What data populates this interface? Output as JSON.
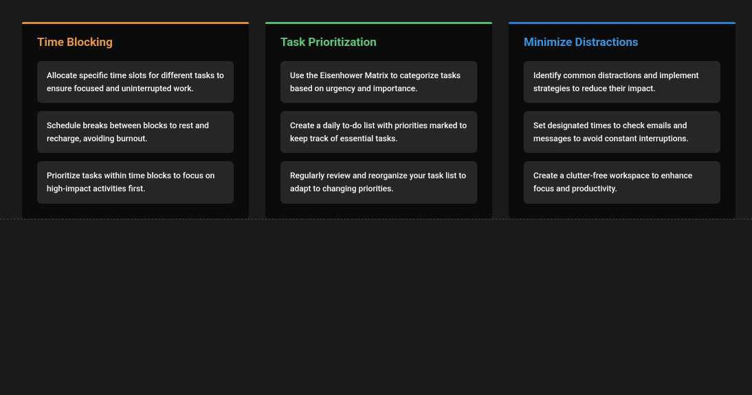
{
  "cards": [
    {
      "title": "Time Blocking",
      "accent": "#e08a3c",
      "title_color": "#e8964a",
      "tips": [
        "Allocate specific time slots for different tasks to ensure focused and uninterrupted work.",
        "Schedule breaks between blocks to rest and recharge, avoiding burnout.",
        "Prioritize tasks within time blocks to focus on high-impact activities first."
      ]
    },
    {
      "title": "Task Prioritization",
      "accent": "#52b96e",
      "title_color": "#5fc77b",
      "tips": [
        "Use the Eisenhower Matrix to categorize tasks based on urgency and importance.",
        "Create a daily to-do list with priorities marked to keep track of essential tasks.",
        "Regularly review and reorganize your task list to adapt to changing priorities."
      ]
    },
    {
      "title": "Minimize Distractions",
      "accent": "#2a7fd4",
      "title_color": "#3a94e0",
      "tips": [
        "Identify common distractions and implement strategies to reduce their impact.",
        "Set designated times to check emails and messages to avoid constant interruptions.",
        "Create a clutter-free workspace to enhance focus and productivity."
      ]
    },
    {
      "title": "",
      "accent": "#8a8a8a",
      "title_color": "#8a8a8a",
      "tips": []
    }
  ]
}
